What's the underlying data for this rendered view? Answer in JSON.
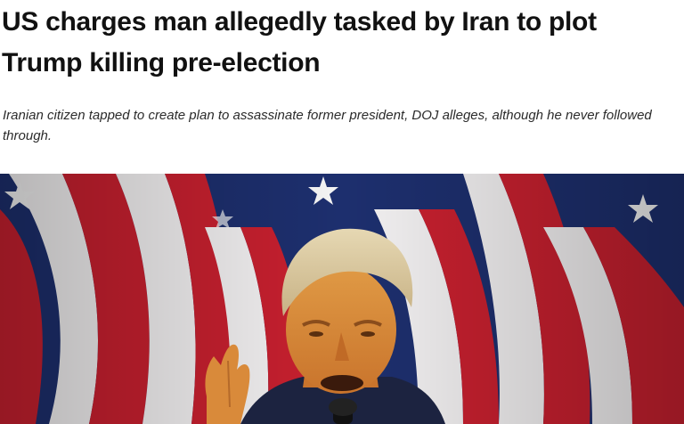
{
  "article": {
    "headline": "US charges man allegedly tasked by Iran to plot Trump killing pre-election",
    "subheadline": "Iranian citizen tapped to create plan to assassinate former president, DOJ alleges, although he never followed through."
  },
  "hero_image": {
    "description_icon": "photo-of-speaker-with-flags",
    "colors": {
      "flag_red": "#c8202f",
      "flag_white": "#f3f1f2",
      "flag_blue": "#1d2f6e",
      "skin": "#d98a3a",
      "hair": "#d9c9a0",
      "suit": "#1c2340"
    }
  }
}
